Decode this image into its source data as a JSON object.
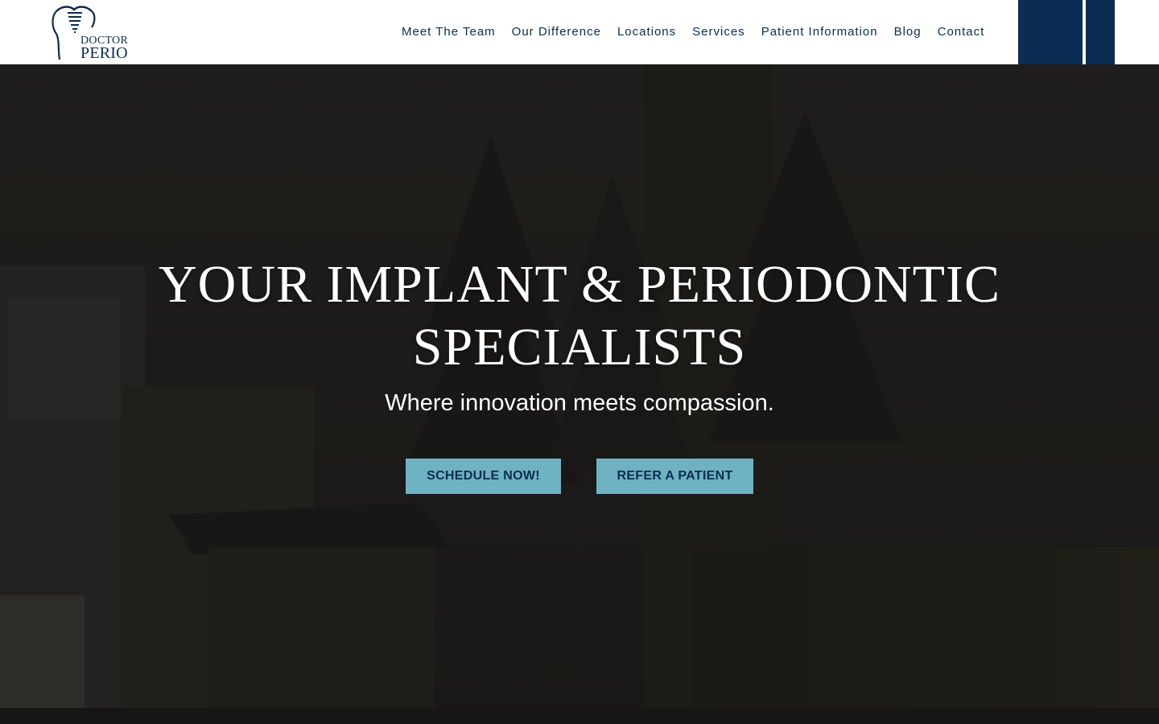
{
  "brand": {
    "logo_line_1": "DOCTOR",
    "logo_line_2": "PERIO",
    "primary_color": "#0b2d53",
    "accent_color": "#6fb2c2"
  },
  "nav": {
    "items": [
      {
        "label": "Meet The Team"
      },
      {
        "label": "Our Difference"
      },
      {
        "label": "Locations"
      },
      {
        "label": "Services"
      },
      {
        "label": "Patient Information"
      },
      {
        "label": "Blog"
      },
      {
        "label": "Contact"
      }
    ]
  },
  "hero": {
    "title_line_1": "YOUR IMPLANT & PERIODONTIC",
    "title_line_2": "SPECIALISTS",
    "subtitle": "Where innovation meets compassion.",
    "buttons": {
      "schedule": "SCHEDULE NOW!",
      "refer": "REFER A PATIENT"
    }
  }
}
